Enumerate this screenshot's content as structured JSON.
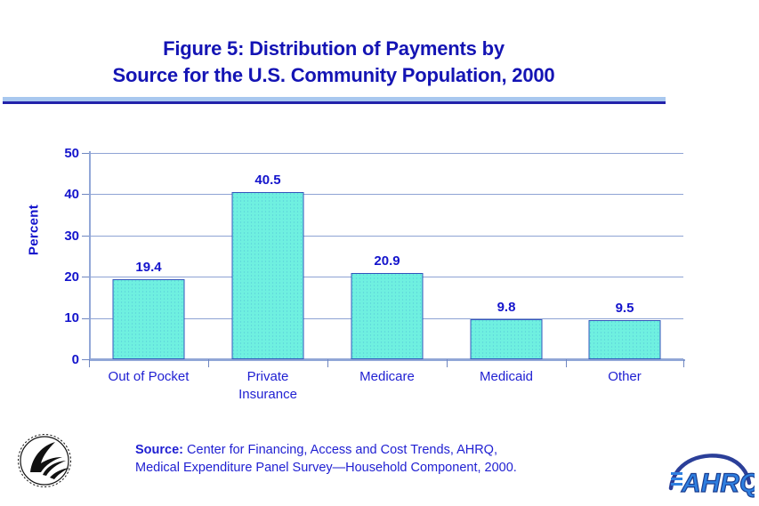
{
  "title": "Figure 5: Distribution of Payments by\nSource for the U.S. Community Population, 2000",
  "chart_data": {
    "type": "bar",
    "title": "Figure 5: Distribution of Payments by Source for the U.S. Community Population, 2000",
    "categories": [
      "Out of Pocket",
      "Private\nInsurance",
      "Medicare",
      "Medicaid",
      "Other"
    ],
    "values": [
      19.4,
      40.5,
      20.9,
      9.8,
      9.5
    ],
    "value_labels": [
      "19.4",
      "40.5",
      "20.9",
      "9.8",
      "9.5"
    ],
    "xlabel": "",
    "ylabel": "Percent",
    "ylim": [
      0,
      50
    ],
    "yticks": [
      0,
      10,
      20,
      30,
      40,
      50
    ],
    "ytick_labels": [
      "0",
      "10",
      "20",
      "30",
      "40",
      "50"
    ],
    "grid": true,
    "legend": false,
    "bar_color": "#6ff0e0",
    "bar_border_color": "#3355bb",
    "text_color": "#1414cc"
  },
  "footer": {
    "source_label": "Source:",
    "source_line1": " Center for Financing, Access and Cost Trends, AHRQ,",
    "source_line2": "Medical Expenditure Panel Survey—Household Component, 2000."
  },
  "logos": {
    "hhs": "hhs-seal-logo",
    "ahrq": "ahrq-logo",
    "ahrq_text": "AHRQ"
  },
  "colors": {
    "title": "#1414b4",
    "rule_dark": "#2222aa",
    "rule_light": "#a8c8ef",
    "gridline": "#8ea3d4",
    "axis": "#92a8d8"
  }
}
